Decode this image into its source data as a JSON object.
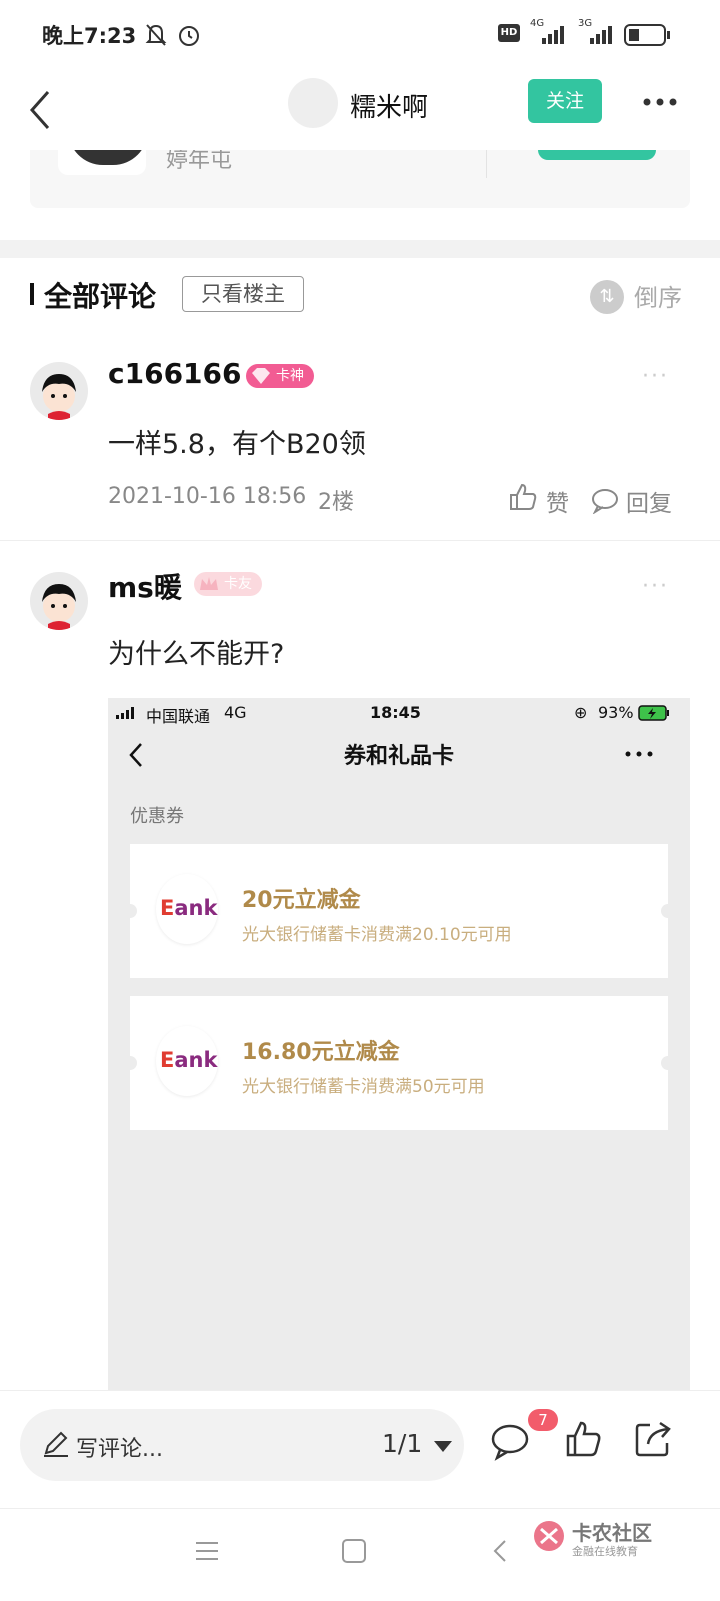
{
  "status_bar": {
    "time": "晚上7:23",
    "net1": "4G",
    "net2": "3G",
    "hd": "HD"
  },
  "header": {
    "title": "糯米啊",
    "follow_label": "关注"
  },
  "partial_card": {
    "text": "婷年屯"
  },
  "comments_header": {
    "title": "全部评论",
    "only_host_label": "只看楼主",
    "sort_label": "倒序"
  },
  "comments": [
    {
      "username": "c166166",
      "badge": "卡神",
      "text": "一样5.8，有个B20领",
      "date": "2021-10-16 18:56",
      "floor": "2楼",
      "like_label": "赞",
      "reply_label": "回复"
    },
    {
      "username": "ms暖",
      "badge": "卡友",
      "text": "为什么不能开?"
    }
  ],
  "embedded_screenshot": {
    "carrier": "中国联通",
    "network": "4G",
    "time": "18:45",
    "battery": "93%",
    "title": "券和礼品卡",
    "section_label": "优惠券",
    "coupons": [
      {
        "logo": "Bank",
        "title": "20元立减金",
        "subtitle": "光大银行储蓄卡消费满20.10元可用"
      },
      {
        "logo": "Bank",
        "title": "16.80元立减金",
        "subtitle": "光大银行储蓄卡消费满50元可用"
      }
    ]
  },
  "bottom_bar": {
    "input_placeholder": "写评论...",
    "page_indicator": "1/1",
    "comment_count": "7"
  },
  "watermark": {
    "name": "卡农社区",
    "tagline": "金融在线教育"
  },
  "colors": {
    "accent": "#33c5a0",
    "badge_pink": "#f25c93",
    "coupon_gold": "#b08a4a"
  }
}
